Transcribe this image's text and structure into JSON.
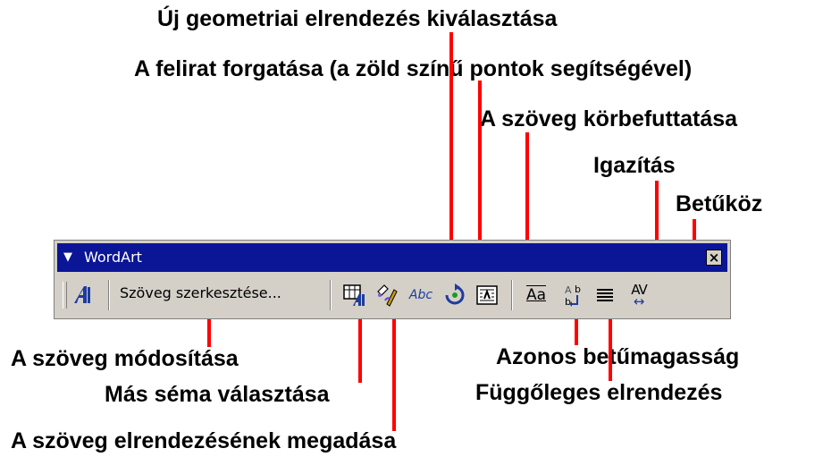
{
  "labels": {
    "geometry": "Új geometriai elrendezés kiválasztása",
    "rotate": "A felirat forgatása (a zöld színű pontok segítségével)",
    "wrap": "A szöveg körbefuttatása",
    "align": "Igazítás",
    "spacing": "Betűköz",
    "edit": "A szöveg módosítása",
    "gallery": "Más séma választása",
    "same_height": "Azonos betűmagasság",
    "vertical": "Függőleges elrendezés",
    "format": "A szöveg elrendezésének megadása"
  },
  "toolbar": {
    "title": "WordArt",
    "menu_glyph": "▼",
    "close_glyph": "×",
    "edit_label": "Szöveg szerkesztése...",
    "shape_label": "Abc",
    "same_height_label": "Aa",
    "spacing_label": "AV"
  },
  "colors": {
    "titlebar": "#0a1696",
    "callout_line": "#ff0000",
    "toolbar_bg": "#d4d0c8"
  }
}
